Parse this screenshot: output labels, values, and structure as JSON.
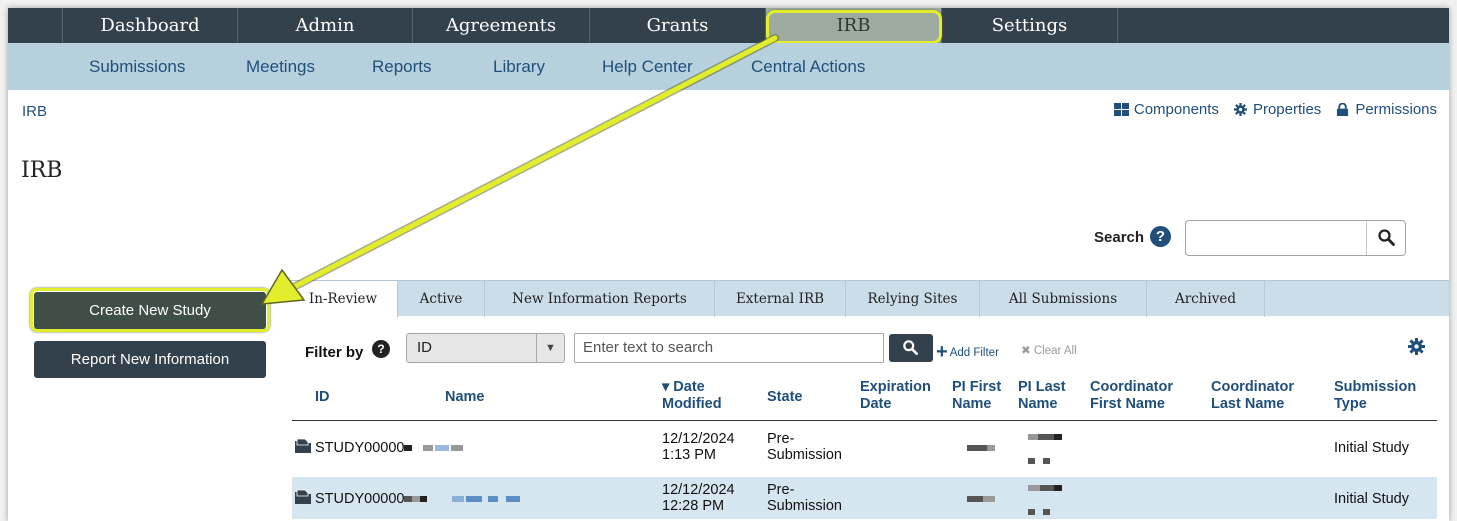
{
  "topnav": {
    "items": [
      "Dashboard",
      "Admin",
      "Agreements",
      "Grants",
      "IRB",
      "Settings"
    ]
  },
  "subnav": {
    "items": [
      "Submissions",
      "Meetings",
      "Reports",
      "Library",
      "Help Center",
      "Central Actions"
    ]
  },
  "breadcrumb": "IRB",
  "page_title": "IRB",
  "toolbar": {
    "components": "Components",
    "properties": "Properties",
    "permissions": "Permissions"
  },
  "search": {
    "label": "Search",
    "help": "?"
  },
  "left_actions": {
    "create_study": "Create New Study",
    "report_info": "Report New Information"
  },
  "tabs": [
    "In-Review",
    "Active",
    "New Information Reports",
    "External IRB",
    "Relying Sites",
    "All Submissions",
    "Archived"
  ],
  "filter": {
    "label": "Filter by",
    "help": "?",
    "selected_field": "ID",
    "placeholder": "Enter text to search",
    "add_filter": "Add Filter",
    "clear_all": "Clear All"
  },
  "table": {
    "headers": {
      "id": "ID",
      "name": "Name",
      "date_modified": [
        "▾ Date",
        "Modified"
      ],
      "state": "State",
      "expiration": [
        "Expiration",
        "Date"
      ],
      "pi_first": [
        "PI First",
        "Name"
      ],
      "pi_last": [
        "PI Last",
        "Name"
      ],
      "coord_first": [
        "Coordinator",
        "First Name"
      ],
      "coord_last": [
        "Coordinator",
        "Last Name"
      ],
      "submission_type": [
        "Submission",
        "Type"
      ]
    },
    "rows": [
      {
        "id": "STUDY00000",
        "date": [
          "12/12/2024",
          "1:13 PM"
        ],
        "state": [
          "Pre-",
          "Submission"
        ],
        "type": "Initial Study"
      },
      {
        "id": "STUDY00000",
        "date": [
          "12/12/2024",
          "12:28 PM"
        ],
        "state": [
          "Pre-",
          "Submission"
        ],
        "type": "Initial Study"
      }
    ]
  },
  "colors": {
    "nav_dark": "#33414d",
    "subnav": "#b7d0de",
    "link": "#1f4f7a",
    "highlight": "#e2ee2b",
    "active_tab": "#9daaa0"
  }
}
